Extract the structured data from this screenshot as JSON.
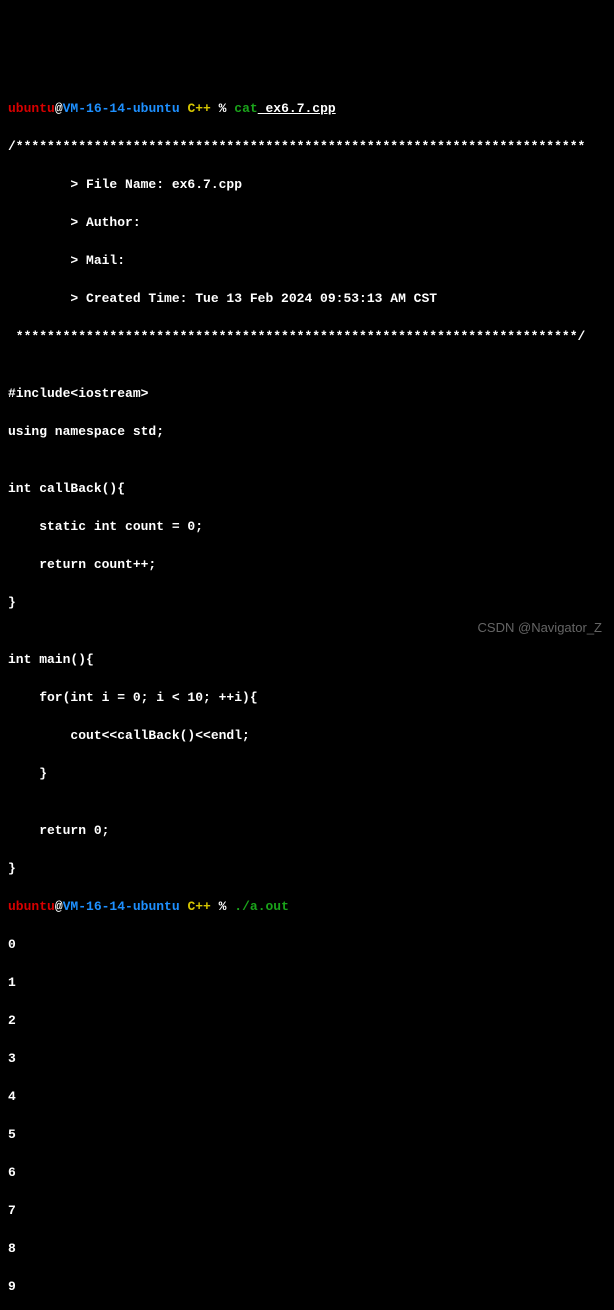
{
  "prompt1": {
    "user": "ubuntu",
    "at": "@",
    "host": "VM-16-14-ubuntu",
    "dir": " C++",
    "pct": " %",
    "cmd": " cat",
    "arg": " ex6.7.cpp"
  },
  "header": {
    "open": "/*************************************************************************",
    "file": "        > File Name: ex6.7.cpp",
    "author": "        > Author: ",
    "mail": "        > Mail: ",
    "ctime": "        > Created Time: Tue 13 Feb 2024 09:53:13 AM CST",
    "close": " ************************************************************************/"
  },
  "src": {
    "blank": "",
    "l1": "#include<iostream>",
    "l2": "using namespace std;",
    "l3": "",
    "l4": "int callBack(){",
    "l5": "    static int count = 0;",
    "l6": "    return count++;",
    "l7": "}",
    "l8": "",
    "l9": "int main(){",
    "l10": "    for(int i = 0; i < 10; ++i){",
    "l11": "        cout<<callBack()<<endl;",
    "l12": "    }",
    "l13": "",
    "l14": "    return 0;",
    "l15": "}"
  },
  "prompt2": {
    "user": "ubuntu",
    "at": "@",
    "host": "VM-16-14-ubuntu",
    "dir": " C++",
    "pct": " %",
    "cmd": " ./a.out"
  },
  "out": {
    "l0": "0",
    "l1": "1",
    "l2": "2",
    "l3": "3",
    "l4": "4",
    "l5": "5",
    "l6": "6",
    "l7": "7",
    "l8": "8",
    "l9": "9"
  },
  "watermark": "CSDN @Navigator_Z"
}
